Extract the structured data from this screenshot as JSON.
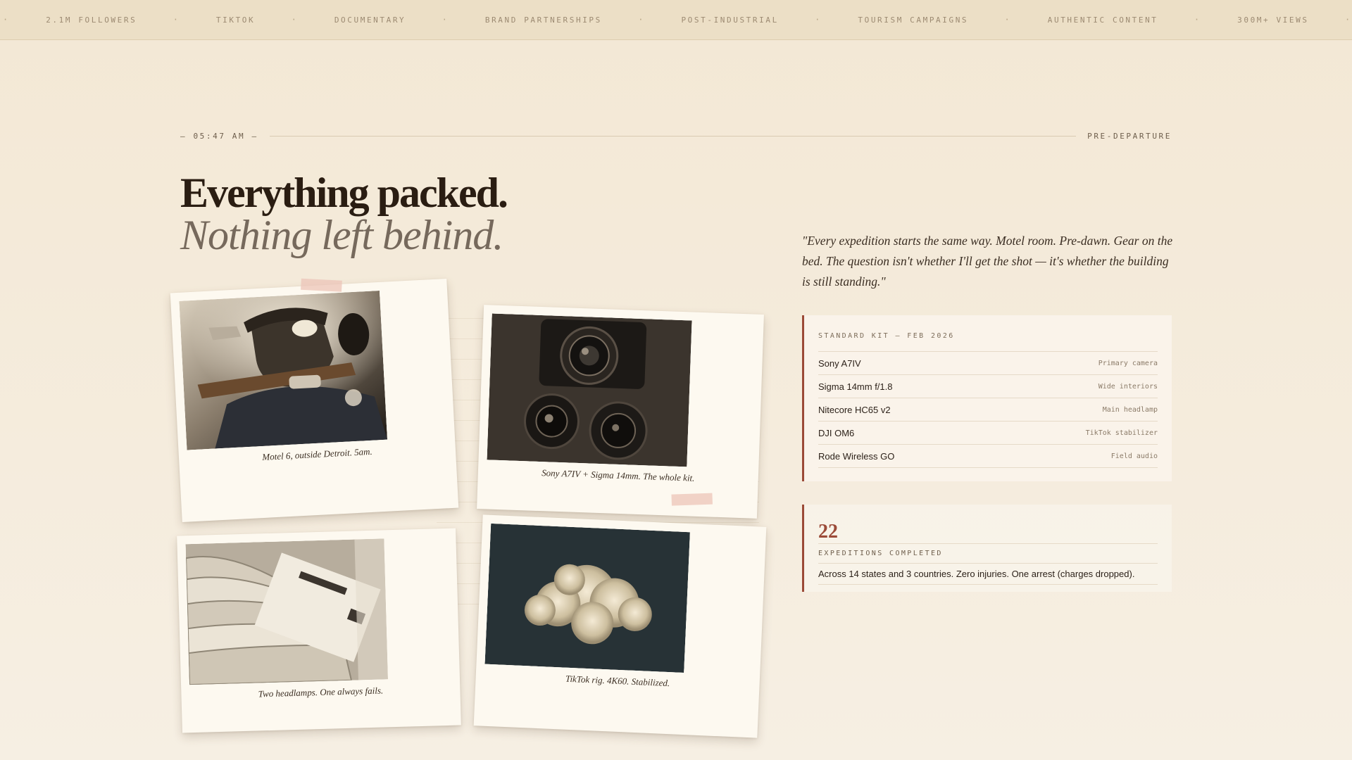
{
  "ticker": {
    "items": [
      "2.1M FOLLOWERS",
      "TIKTOK",
      "DOCUMENTARY",
      "BRAND PARTNERSHIPS",
      "POST-INDUSTRIAL",
      "TOURISM CAMPAIGNS",
      "AUTHENTIC CONTENT",
      "300M+ VIEWS"
    ],
    "separator": "·"
  },
  "meta": {
    "time": "— 05:47 AM —",
    "status": "PRE-DEPARTURE"
  },
  "headline": {
    "line1": "Everything packed.",
    "line2": "Nothing left behind."
  },
  "photos": [
    {
      "caption": "Motel 6, outside Detroit. 5am."
    },
    {
      "caption": "Sony A7IV + Sigma 14mm. The whole kit."
    },
    {
      "caption": "Two headlamps. One always fails."
    },
    {
      "caption": "TikTok rig. 4K60. Stabilized."
    }
  ],
  "quote": "\"Every expedition starts the same way. Motel room. Pre-dawn. Gear on the bed. The question isn't whether I'll get the shot — it's whether the building is still standing.\"",
  "kit": {
    "title": "STANDARD KIT — FEB 2026",
    "items": [
      {
        "name": "Sony A7IV",
        "role": "Primary camera"
      },
      {
        "name": "Sigma 14mm f/1.8",
        "role": "Wide interiors"
      },
      {
        "name": "Nitecore HC65 v2",
        "role": "Main headlamp"
      },
      {
        "name": "DJI OM6",
        "role": "TikTok stabilizer"
      },
      {
        "name": "Rode Wireless GO",
        "role": "Field audio"
      }
    ]
  },
  "stats": {
    "number": "22",
    "label": "EXPEDITIONS COMPLETED",
    "description": "Across 14 states and 3 countries. Zero injuries. One arrest (charges dropped)."
  },
  "colors": {
    "accent": "#9b4a37",
    "background": "#f3e8d5",
    "ticker_bg": "#ecdfc6"
  }
}
